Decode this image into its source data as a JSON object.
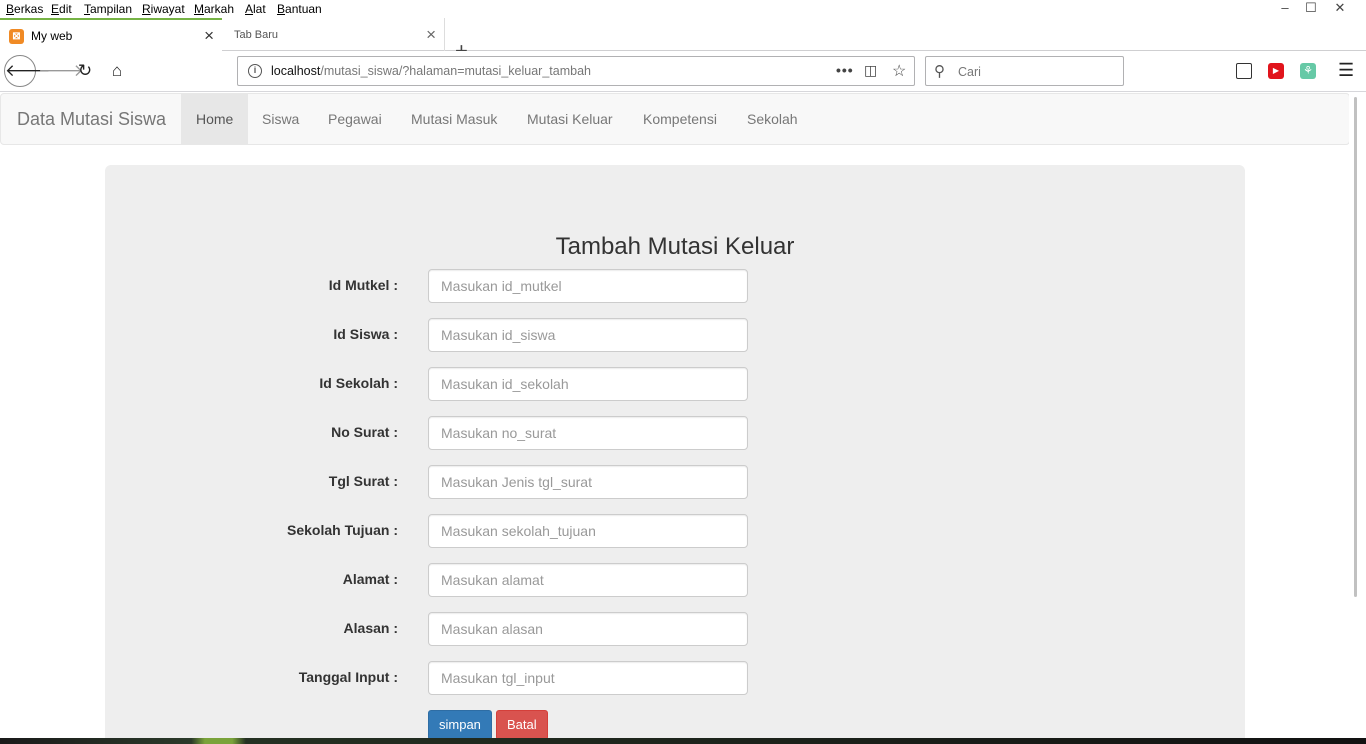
{
  "menubar": {
    "items": [
      {
        "u": "B",
        "rest": "erkas"
      },
      {
        "u": "E",
        "rest": "dit"
      },
      {
        "u": "T",
        "rest": "ampilan"
      },
      {
        "u": "R",
        "rest": "iwayat"
      },
      {
        "u": "M",
        "rest": "arkah"
      },
      {
        "u": "A",
        "rest": "lat"
      },
      {
        "u": "B",
        "rest": "antuan"
      }
    ]
  },
  "window_controls": {
    "minimize": "–",
    "maximize": "☐",
    "close": "✕"
  },
  "tabs": [
    {
      "title": "My web",
      "active": true
    },
    {
      "title": "Tab Baru",
      "active": false
    }
  ],
  "browser": {
    "url_host": "localhost",
    "url_path": "/mutasi_siswa/?halaman=mutasi_keluar_tambah",
    "search_placeholder": "Cari"
  },
  "site": {
    "brand": "Data Mutasi Siswa",
    "nav": [
      "Home",
      "Siswa",
      "Pegawai",
      "Mutasi Masuk",
      "Mutasi Keluar",
      "Kompetensi",
      "Sekolah"
    ],
    "active_nav": "Home"
  },
  "form": {
    "title": "Tambah Mutasi Keluar",
    "fields": [
      {
        "label": "Id Mutkel :",
        "placeholder": "Masukan id_mutkel"
      },
      {
        "label": "Id Siswa :",
        "placeholder": "Masukan id_siswa"
      },
      {
        "label": "Id Sekolah :",
        "placeholder": "Masukan id_sekolah"
      },
      {
        "label": "No Surat :",
        "placeholder": "Masukan no_surat"
      },
      {
        "label": "Tgl Surat :",
        "placeholder": "Masukan Jenis tgl_surat"
      },
      {
        "label": "Sekolah Tujuan :",
        "placeholder": "Masukan sekolah_tujuan"
      },
      {
        "label": "Alamat :",
        "placeholder": "Masukan alamat"
      },
      {
        "label": "Alasan :",
        "placeholder": "Masukan alasan"
      },
      {
        "label": "Tanggal Input :",
        "placeholder": "Masukan tgl_input"
      }
    ],
    "submit_label": "simpan",
    "cancel_label": "Batal"
  },
  "colors": {
    "tab_accent": "#76b345",
    "primary": "#337ab7",
    "danger": "#d9534f",
    "jumbotron_bg": "#eeeeee",
    "navbar_bg": "#f8f8f8"
  }
}
